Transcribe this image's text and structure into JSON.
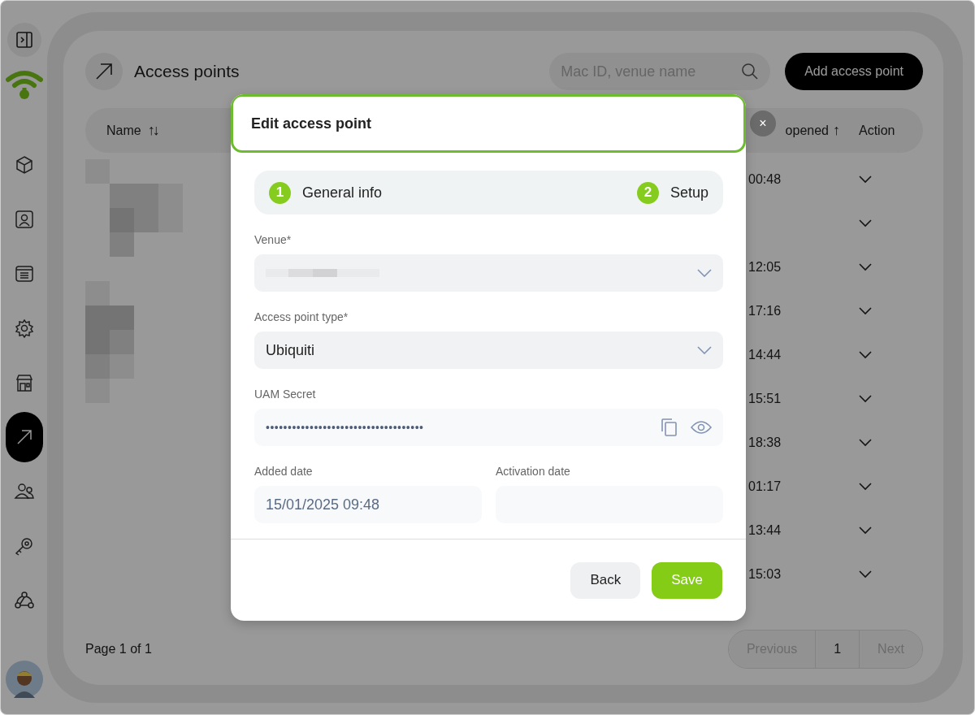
{
  "sidebar": {
    "items": [
      {
        "kind": "cube",
        "selected": false
      },
      {
        "kind": "contact",
        "selected": false
      },
      {
        "kind": "list",
        "selected": false
      },
      {
        "kind": "gear",
        "selected": false
      },
      {
        "kind": "store",
        "selected": false
      },
      {
        "kind": "arrow",
        "selected": true
      },
      {
        "kind": "users",
        "selected": false
      },
      {
        "kind": "key",
        "selected": false
      },
      {
        "kind": "webhook",
        "selected": false
      }
    ]
  },
  "page": {
    "title": "Access points",
    "search": {
      "placeholder": "Mac ID, venue name"
    },
    "add_button": "Add access point"
  },
  "table": {
    "columns": [
      {
        "label": "Name",
        "sort_icon": "↑↓"
      },
      {
        "label": "opened",
        "sort_icon": "↑"
      },
      {
        "label": "Action"
      }
    ],
    "rows": [
      {
        "time": "00:48"
      },
      {},
      {
        "time": "12:05"
      },
      {
        "time": "17:16"
      },
      {
        "time": "14:44"
      },
      {
        "time": "15:51"
      },
      {
        "time": "18:38"
      },
      {
        "time": "01:17"
      },
      {
        "time": "13:44"
      },
      {
        "time": "15:03"
      }
    ]
  },
  "pagination": {
    "label": "Page 1 of 1",
    "buttons": [
      {
        "label": "Previous",
        "disabled": true
      },
      {
        "label": "1",
        "disabled": false
      },
      {
        "label": "Next",
        "disabled": true
      }
    ]
  },
  "dialog": {
    "title": "Edit access point",
    "close": "×",
    "steps": [
      {
        "number": "1",
        "label": "General info"
      },
      {
        "number": "2",
        "label": "Setup"
      }
    ],
    "fields": [
      {
        "kind": "select",
        "label": "Venue*",
        "redacted": true
      },
      {
        "kind": "select",
        "label": "Access point type*",
        "value": "Ubiquiti"
      },
      {
        "kind": "secret",
        "label": "UAM Secret",
        "value": "••••••••••••••••••••••••••••••••••••"
      }
    ],
    "dates": [
      {
        "label": "Added date",
        "value": "15/01/2025 09:48"
      },
      {
        "label": "Activation date"
      }
    ],
    "buttons": [
      {
        "label": "Back",
        "kind": "secondary"
      },
      {
        "label": "Save",
        "kind": "primary"
      }
    ]
  }
}
